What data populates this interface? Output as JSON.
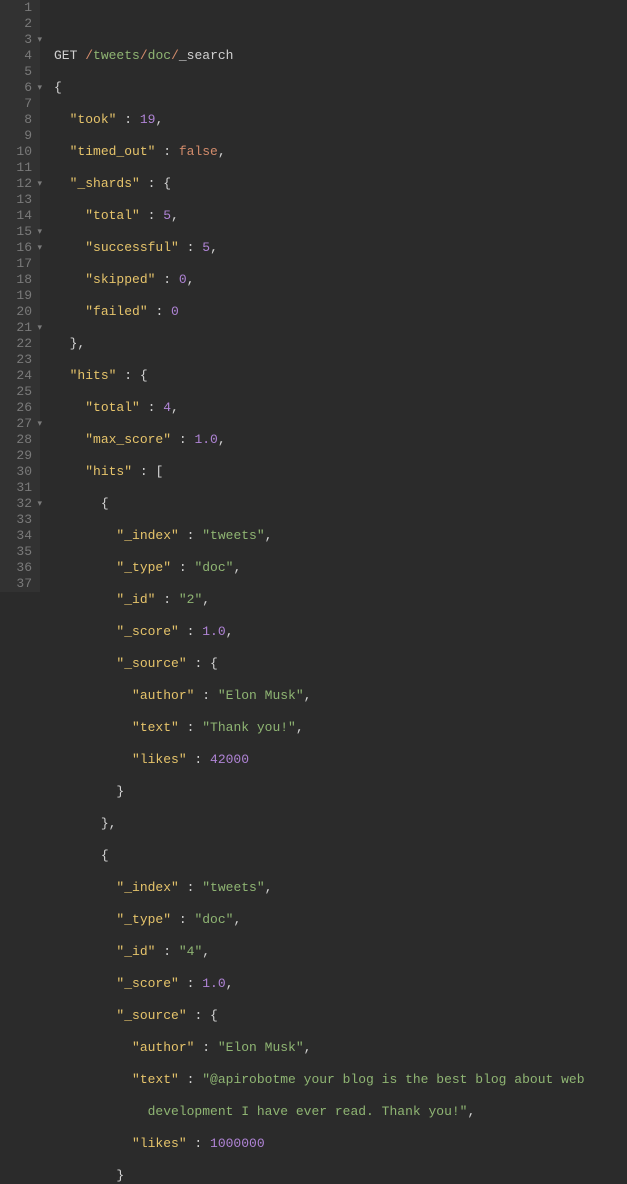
{
  "lines": {
    "1": "",
    "2_method": "GET ",
    "2_p1": "/",
    "2_p2": "tweets",
    "2_p3": "/",
    "2_p4": "doc",
    "2_p5": "/",
    "2_p6": "_search",
    "3": "{",
    "4_k": "\"took\"",
    "4_v": "19",
    "5_k": "\"timed_out\"",
    "5_v": "false",
    "6_k": "\"_shards\"",
    "7_k": "\"total\"",
    "7_v": "5",
    "8_k": "\"successful\"",
    "8_v": "5",
    "9_k": "\"skipped\"",
    "9_v": "0",
    "10_k": "\"failed\"",
    "10_v": "0",
    "12_k": "\"hits\"",
    "13_k": "\"total\"",
    "13_v": "4",
    "14_k": "\"max_score\"",
    "14_v": "1.0",
    "15_k": "\"hits\"",
    "17_k": "\"_index\"",
    "17_v": "\"tweets\"",
    "18_k": "\"_type\"",
    "18_v": "\"doc\"",
    "19_k": "\"_id\"",
    "19_v": "\"2\"",
    "20_k": "\"_score\"",
    "20_v": "1.0",
    "21_k": "\"_source\"",
    "22_k": "\"author\"",
    "22_v": "\"Elon Musk\"",
    "23_k": "\"text\"",
    "23_v": "\"Thank you!\"",
    "24_k": "\"likes\"",
    "24_v": "42000",
    "28_k": "\"_index\"",
    "28_v": "\"tweets\"",
    "29_k": "\"_type\"",
    "29_v": "\"doc\"",
    "30_k": "\"_id\"",
    "30_v": "\"4\"",
    "31_k": "\"_score\"",
    "31_v": "1.0",
    "32_k": "\"_source\"",
    "33_k": "\"author\"",
    "33_v": "\"Elon Musk\"",
    "34_k": "\"text\"",
    "34_v": "\"@apirobotme your blog is the best blog about web",
    "35_v": "development I have ever read. Thank you!\"",
    "36_k": "\"likes\"",
    "36_v": "1000000"
  },
  "gutter": [
    "1",
    "2",
    "3",
    "4",
    "5",
    "6",
    "7",
    "8",
    "9",
    "10",
    "11",
    "12",
    "13",
    "14",
    "15",
    "16",
    "17",
    "18",
    "19",
    "20",
    "21",
    "22",
    "23",
    "24",
    "25",
    "26",
    "27",
    "28",
    "29",
    "30",
    "31",
    "32",
    "33",
    "34",
    "35",
    "36",
    "37"
  ]
}
